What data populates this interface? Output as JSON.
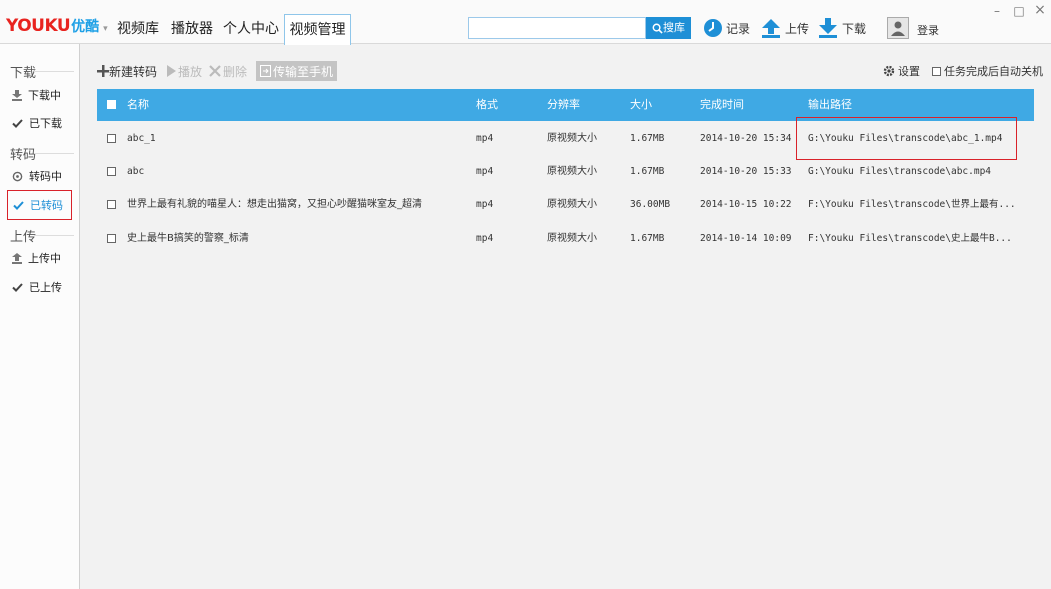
{
  "app": {
    "logo_main": "YOUKU",
    "logo_sub": "优酷"
  },
  "nav": {
    "tabs": [
      "视频库",
      "播放器",
      "个人中心",
      "视频管理"
    ],
    "active": "视频管理"
  },
  "search": {
    "placeholder": "",
    "button_label": "搜库"
  },
  "top_actions": {
    "record": "记录",
    "upload": "上传",
    "download": "下载",
    "login": "登录"
  },
  "window": {
    "minimize": "–",
    "maximize": "□",
    "close": "×"
  },
  "sidebar": {
    "sections": [
      {
        "title": "下载",
        "items": [
          "下载中",
          "已下载"
        ]
      },
      {
        "title": "转码",
        "items": [
          "转码中",
          "已转码"
        ]
      },
      {
        "title": "上传",
        "items": [
          "上传中",
          "已上传"
        ]
      }
    ],
    "selected": "已转码"
  },
  "toolbar": {
    "new_transcode": "新建转码",
    "play": "播放",
    "delete": "删除",
    "transfer": "传输至手机",
    "settings": "设置",
    "auto_shutdown": "任务完成后自动关机"
  },
  "table": {
    "columns": [
      "名称",
      "格式",
      "分辨率",
      "大小",
      "完成时间",
      "输出路径"
    ],
    "rows": [
      {
        "name": "abc_1",
        "format": "mp4",
        "resolution": "原视频大小",
        "size": "1.67MB",
        "time": "2014-10-20 15:34",
        "path": "G:\\Youku Files\\transcode\\abc_1.mp4"
      },
      {
        "name": "abc",
        "format": "mp4",
        "resolution": "原视频大小",
        "size": "1.67MB",
        "time": "2014-10-20 15:33",
        "path": "G:\\Youku Files\\transcode\\abc.mp4"
      },
      {
        "name": "世界上最有礼貌的喵星人：想走出猫窝，又担心吵醒猫咪室友_超清",
        "format": "mp4",
        "resolution": "原视频大小",
        "size": "36.00MB",
        "time": "2014-10-15 10:22",
        "path": "F:\\Youku Files\\transcode\\世界上最有..."
      },
      {
        "name": "史上最牛B搞笑的警察_标清",
        "format": "mp4",
        "resolution": "原视频大小",
        "size": "1.67MB",
        "time": "2014-10-14 10:09",
        "path": "F:\\Youku Files\\transcode\\史上最牛B..."
      }
    ]
  },
  "colors": {
    "accent": "#3fa9e4",
    "brand_red": "#e8231f",
    "highlight": "#d9222a"
  }
}
